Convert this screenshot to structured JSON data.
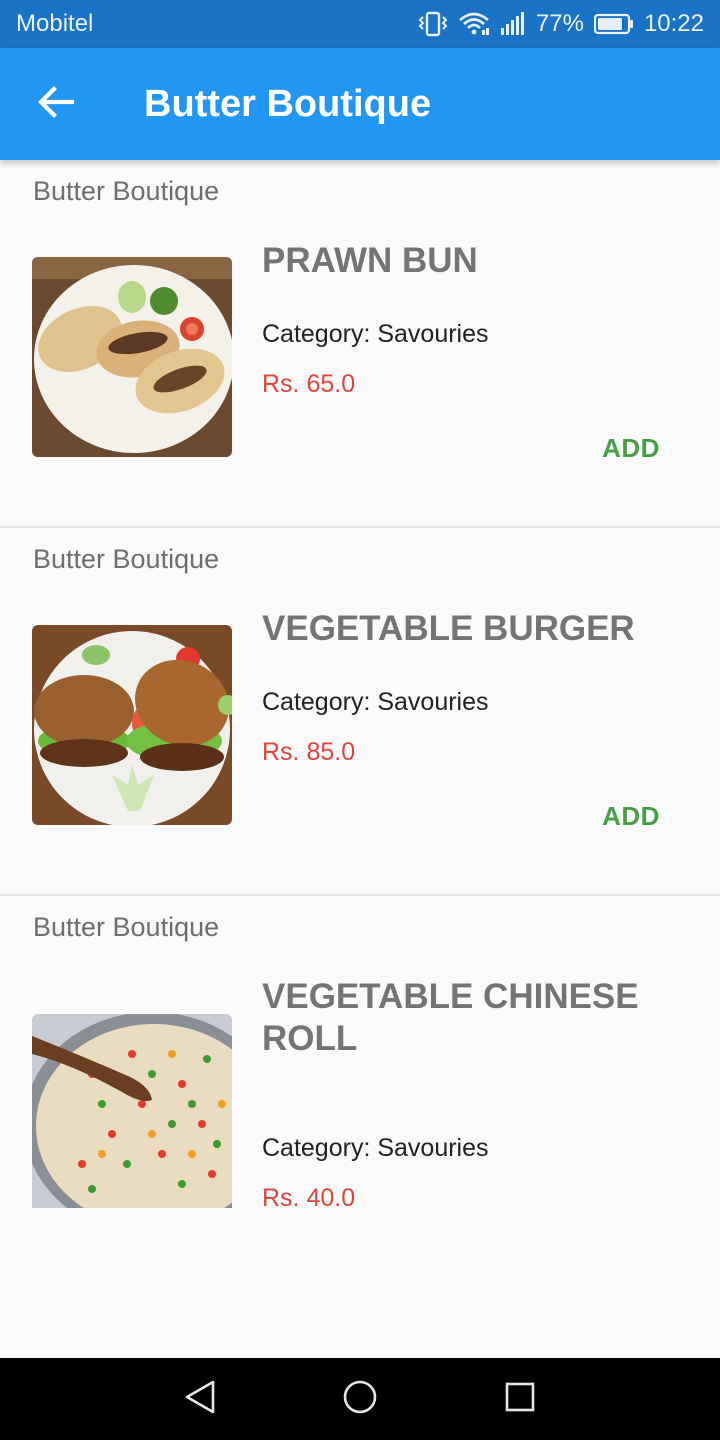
{
  "status_bar": {
    "carrier": "Mobitel",
    "battery": "77%",
    "time": "10:22",
    "icons": [
      "vibrate-icon",
      "wifi-icon",
      "signal-icon",
      "battery-icon"
    ]
  },
  "app_bar": {
    "back_icon": "arrow-left-icon",
    "title": "Butter Boutique"
  },
  "colors": {
    "status_bar": "#1a73c4",
    "app_bar": "#2196f3",
    "price": "#e0443a",
    "add": "#43a047",
    "name": "#747474"
  },
  "items": [
    {
      "restaurant": "Butter Boutique",
      "name": "PRAWN BUN",
      "category": "Category: Savouries",
      "price": "Rs. 65.0",
      "add_label": "ADD"
    },
    {
      "restaurant": "Butter Boutique",
      "name": "VEGETABLE BURGER",
      "category": "Category: Savouries",
      "price": "Rs. 85.0",
      "add_label": "ADD"
    },
    {
      "restaurant": "Butter Boutique",
      "name": "VEGETABLE CHINESE ROLL",
      "category": "Category: Savouries",
      "price": "Rs. 40.0"
    }
  ],
  "nav_bar": {
    "buttons": [
      "back-triangle-icon",
      "home-circle-icon",
      "recents-square-icon"
    ]
  }
}
